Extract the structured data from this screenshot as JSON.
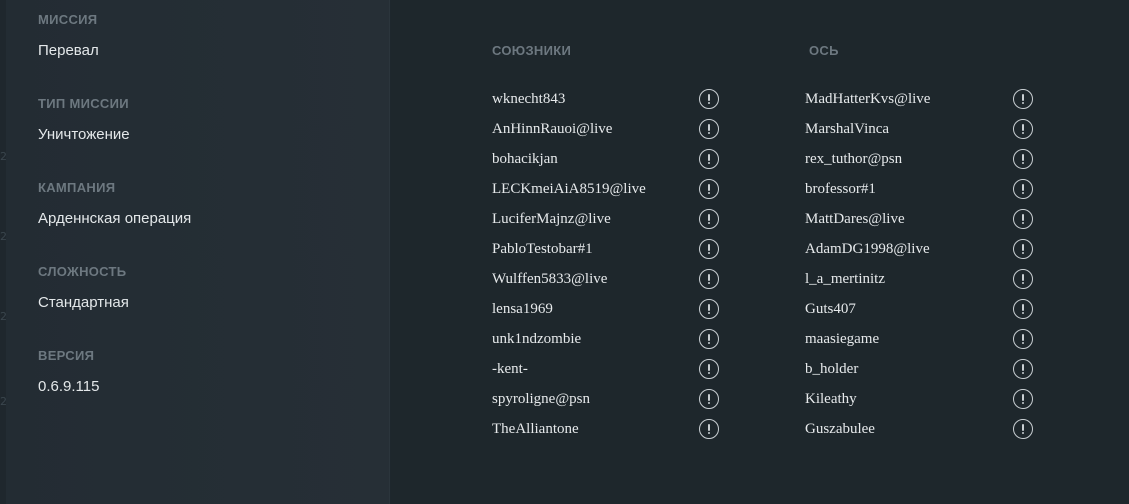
{
  "mission_info": [
    {
      "label": "МИССИЯ",
      "value": "Перевал"
    },
    {
      "label": "ТИП МИССИИ",
      "value": "Уничтожение"
    },
    {
      "label": "КАМПАНИЯ",
      "value": "Арденнская операция"
    },
    {
      "label": "СЛОЖНОСТЬ",
      "value": "Стандартная"
    },
    {
      "label": "ВЕРСИЯ",
      "value": "0.6.9.115"
    }
  ],
  "teams": {
    "allies": {
      "header": "СОЮЗНИКИ",
      "players": [
        "wknecht843",
        "AnHinnRauoi@live",
        "bohacikjan",
        "LECKmeiAiA8519@live",
        "LuciferMajnz@live",
        "PabloTestobar#1",
        "Wulffen5833@live",
        "lensa1969",
        "unk1ndzombie",
        "-kent-",
        "spyroligne@psn",
        "TheAlliantone"
      ]
    },
    "axis": {
      "header": "ОСЬ",
      "players": [
        "MadHatterKvs@live",
        "MarshalVinca",
        "rex_tuthor@psn",
        "brofessor#1",
        "MattDares@live",
        "AdamDG1998@live",
        "l_a_mertinitz",
        "Guts407",
        "maasiegame",
        "b_holder",
        "Kileathy",
        "Guszabulee"
      ]
    }
  },
  "icons": {
    "report": "exclamation-circle-icon"
  },
  "colors": {
    "background": "#1e272c",
    "left_panel": "#252e35",
    "label": "#6d7880",
    "text": "#e4e8ea",
    "icon": "#c9cfd3"
  }
}
